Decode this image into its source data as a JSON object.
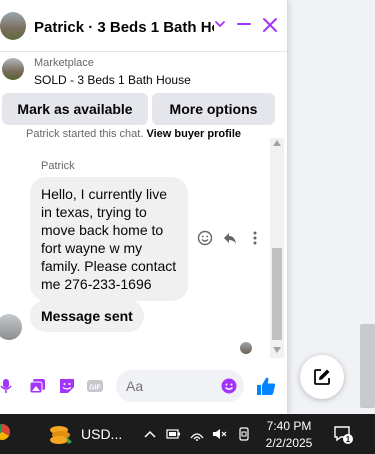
{
  "header": {
    "title": "Patrick · 3 Beds 1 Bath Hou…",
    "accent_color": "#a334fa"
  },
  "listing": {
    "source": "Marketplace",
    "title": "SOLD - 3 Beds 1 Bath House"
  },
  "actions": {
    "mark_available": "Mark as available",
    "more_options": "More options"
  },
  "messages": {
    "started_text": "Patrick started this chat.",
    "view_profile": "View buyer profile",
    "sender": "Patrick",
    "message1": "Hello, I currently live in texas, trying to move back home to fort wayne w my family. Please contact me 276-233-1696",
    "message2": "Message sent"
  },
  "composer": {
    "placeholder": "Aa",
    "like_color": "#0084ff"
  },
  "taskbar": {
    "app_label": "USD...",
    "time": "7:40 PM",
    "date": "2/2/2025",
    "notification_count": "1"
  }
}
